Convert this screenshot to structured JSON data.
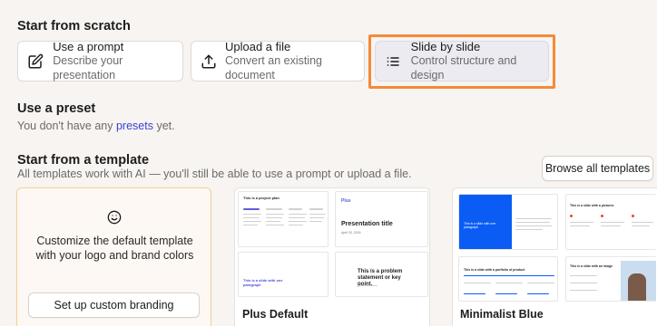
{
  "scratch": {
    "heading": "Start from scratch",
    "options": [
      {
        "title": "Use a prompt",
        "desc": "Describe your presentation",
        "icon": "edit-icon"
      },
      {
        "title": "Upload a file",
        "desc": "Convert an existing document",
        "icon": "upload-icon"
      },
      {
        "title": "Slide by slide",
        "desc": "Control structure and design",
        "icon": "list-icon"
      }
    ]
  },
  "preset": {
    "heading": "Use a preset",
    "text_before": "You don't have any ",
    "link": "presets",
    "text_after": " yet."
  },
  "template": {
    "heading": "Start from a template",
    "subtitle": "All templates work with AI — you'll still be able to use a prompt or upload a file.",
    "browse_button": "Browse all templates",
    "branding": {
      "text": "Customize the default template with your logo and brand colors",
      "button": "Set up custom branding",
      "icon": "smiley-icon"
    },
    "items": [
      {
        "name": "Plus Default",
        "thumbs": {
          "a_title": "This is a project plan",
          "b_brand": "Plus",
          "b_title": "Presentation title",
          "b_date": "April 20, 2024",
          "c_title": "This is a slide with one paragraph",
          "d_title": "This is a problem statement or key point."
        }
      },
      {
        "name": "Minimalist Blue",
        "thumbs": {
          "a_text": "This is a slide with one paragraph",
          "b_title": "This is a slide with a pictures",
          "c_title": "This is a slide with a portfolio of product",
          "d_title": "This is a slide with an image"
        }
      }
    ]
  },
  "colors": {
    "highlight": "#f48a3a",
    "link": "#3b3fd8",
    "brand_card_border": "#f3cf97",
    "minimalist_blue": "#0a5cf5"
  }
}
